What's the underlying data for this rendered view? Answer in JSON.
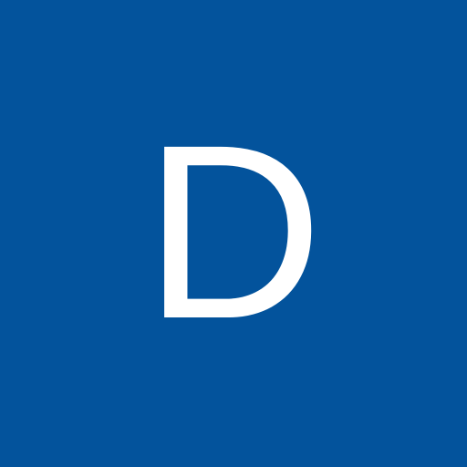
{
  "avatar": {
    "initial": "D",
    "background_color": "#03539C",
    "text_color": "#FFFFFF"
  }
}
